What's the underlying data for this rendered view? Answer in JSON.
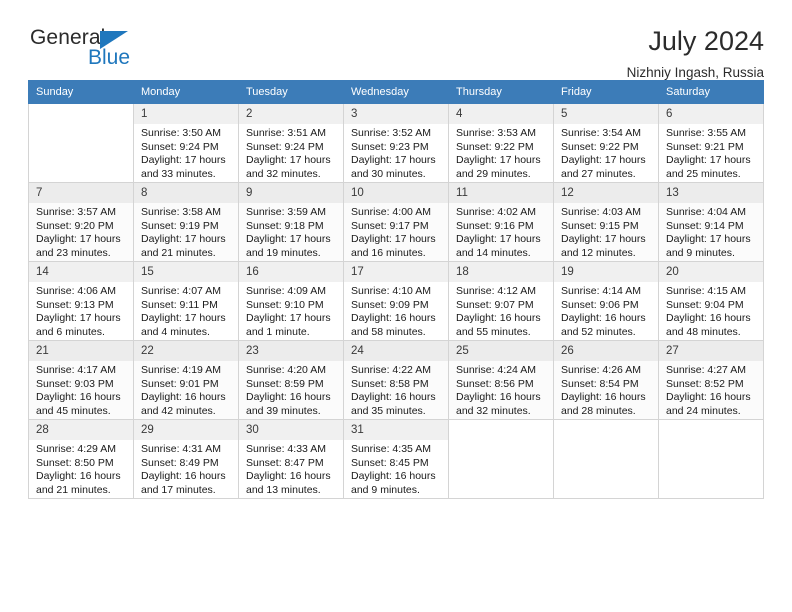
{
  "brand": {
    "name_dark": "General",
    "name_blue": "Blue",
    "accent_color": "#1f77bd",
    "header_color": "#3c7cb8"
  },
  "header": {
    "title": "July 2024",
    "subtitle": "Nizhniy Ingash, Russia"
  },
  "calendar": {
    "weekdays": [
      "Sunday",
      "Monday",
      "Tuesday",
      "Wednesday",
      "Thursday",
      "Friday",
      "Saturday"
    ],
    "weeks": [
      [
        {
          "day": "",
          "sunrise": "",
          "sunset": "",
          "daylight1": "",
          "daylight2": ""
        },
        {
          "day": "1",
          "sunrise": "Sunrise: 3:50 AM",
          "sunset": "Sunset: 9:24 PM",
          "daylight1": "Daylight: 17 hours",
          "daylight2": "and 33 minutes."
        },
        {
          "day": "2",
          "sunrise": "Sunrise: 3:51 AM",
          "sunset": "Sunset: 9:24 PM",
          "daylight1": "Daylight: 17 hours",
          "daylight2": "and 32 minutes."
        },
        {
          "day": "3",
          "sunrise": "Sunrise: 3:52 AM",
          "sunset": "Sunset: 9:23 PM",
          "daylight1": "Daylight: 17 hours",
          "daylight2": "and 30 minutes."
        },
        {
          "day": "4",
          "sunrise": "Sunrise: 3:53 AM",
          "sunset": "Sunset: 9:22 PM",
          "daylight1": "Daylight: 17 hours",
          "daylight2": "and 29 minutes."
        },
        {
          "day": "5",
          "sunrise": "Sunrise: 3:54 AM",
          "sunset": "Sunset: 9:22 PM",
          "daylight1": "Daylight: 17 hours",
          "daylight2": "and 27 minutes."
        },
        {
          "day": "6",
          "sunrise": "Sunrise: 3:55 AM",
          "sunset": "Sunset: 9:21 PM",
          "daylight1": "Daylight: 17 hours",
          "daylight2": "and 25 minutes."
        }
      ],
      [
        {
          "day": "7",
          "sunrise": "Sunrise: 3:57 AM",
          "sunset": "Sunset: 9:20 PM",
          "daylight1": "Daylight: 17 hours",
          "daylight2": "and 23 minutes."
        },
        {
          "day": "8",
          "sunrise": "Sunrise: 3:58 AM",
          "sunset": "Sunset: 9:19 PM",
          "daylight1": "Daylight: 17 hours",
          "daylight2": "and 21 minutes."
        },
        {
          "day": "9",
          "sunrise": "Sunrise: 3:59 AM",
          "sunset": "Sunset: 9:18 PM",
          "daylight1": "Daylight: 17 hours",
          "daylight2": "and 19 minutes."
        },
        {
          "day": "10",
          "sunrise": "Sunrise: 4:00 AM",
          "sunset": "Sunset: 9:17 PM",
          "daylight1": "Daylight: 17 hours",
          "daylight2": "and 16 minutes."
        },
        {
          "day": "11",
          "sunrise": "Sunrise: 4:02 AM",
          "sunset": "Sunset: 9:16 PM",
          "daylight1": "Daylight: 17 hours",
          "daylight2": "and 14 minutes."
        },
        {
          "day": "12",
          "sunrise": "Sunrise: 4:03 AM",
          "sunset": "Sunset: 9:15 PM",
          "daylight1": "Daylight: 17 hours",
          "daylight2": "and 12 minutes."
        },
        {
          "day": "13",
          "sunrise": "Sunrise: 4:04 AM",
          "sunset": "Sunset: 9:14 PM",
          "daylight1": "Daylight: 17 hours",
          "daylight2": "and 9 minutes."
        }
      ],
      [
        {
          "day": "14",
          "sunrise": "Sunrise: 4:06 AM",
          "sunset": "Sunset: 9:13 PM",
          "daylight1": "Daylight: 17 hours",
          "daylight2": "and 6 minutes."
        },
        {
          "day": "15",
          "sunrise": "Sunrise: 4:07 AM",
          "sunset": "Sunset: 9:11 PM",
          "daylight1": "Daylight: 17 hours",
          "daylight2": "and 4 minutes."
        },
        {
          "day": "16",
          "sunrise": "Sunrise: 4:09 AM",
          "sunset": "Sunset: 9:10 PM",
          "daylight1": "Daylight: 17 hours",
          "daylight2": "and 1 minute."
        },
        {
          "day": "17",
          "sunrise": "Sunrise: 4:10 AM",
          "sunset": "Sunset: 9:09 PM",
          "daylight1": "Daylight: 16 hours",
          "daylight2": "and 58 minutes."
        },
        {
          "day": "18",
          "sunrise": "Sunrise: 4:12 AM",
          "sunset": "Sunset: 9:07 PM",
          "daylight1": "Daylight: 16 hours",
          "daylight2": "and 55 minutes."
        },
        {
          "day": "19",
          "sunrise": "Sunrise: 4:14 AM",
          "sunset": "Sunset: 9:06 PM",
          "daylight1": "Daylight: 16 hours",
          "daylight2": "and 52 minutes."
        },
        {
          "day": "20",
          "sunrise": "Sunrise: 4:15 AM",
          "sunset": "Sunset: 9:04 PM",
          "daylight1": "Daylight: 16 hours",
          "daylight2": "and 48 minutes."
        }
      ],
      [
        {
          "day": "21",
          "sunrise": "Sunrise: 4:17 AM",
          "sunset": "Sunset: 9:03 PM",
          "daylight1": "Daylight: 16 hours",
          "daylight2": "and 45 minutes."
        },
        {
          "day": "22",
          "sunrise": "Sunrise: 4:19 AM",
          "sunset": "Sunset: 9:01 PM",
          "daylight1": "Daylight: 16 hours",
          "daylight2": "and 42 minutes."
        },
        {
          "day": "23",
          "sunrise": "Sunrise: 4:20 AM",
          "sunset": "Sunset: 8:59 PM",
          "daylight1": "Daylight: 16 hours",
          "daylight2": "and 39 minutes."
        },
        {
          "day": "24",
          "sunrise": "Sunrise: 4:22 AM",
          "sunset": "Sunset: 8:58 PM",
          "daylight1": "Daylight: 16 hours",
          "daylight2": "and 35 minutes."
        },
        {
          "day": "25",
          "sunrise": "Sunrise: 4:24 AM",
          "sunset": "Sunset: 8:56 PM",
          "daylight1": "Daylight: 16 hours",
          "daylight2": "and 32 minutes."
        },
        {
          "day": "26",
          "sunrise": "Sunrise: 4:26 AM",
          "sunset": "Sunset: 8:54 PM",
          "daylight1": "Daylight: 16 hours",
          "daylight2": "and 28 minutes."
        },
        {
          "day": "27",
          "sunrise": "Sunrise: 4:27 AM",
          "sunset": "Sunset: 8:52 PM",
          "daylight1": "Daylight: 16 hours",
          "daylight2": "and 24 minutes."
        }
      ],
      [
        {
          "day": "28",
          "sunrise": "Sunrise: 4:29 AM",
          "sunset": "Sunset: 8:50 PM",
          "daylight1": "Daylight: 16 hours",
          "daylight2": "and 21 minutes."
        },
        {
          "day": "29",
          "sunrise": "Sunrise: 4:31 AM",
          "sunset": "Sunset: 8:49 PM",
          "daylight1": "Daylight: 16 hours",
          "daylight2": "and 17 minutes."
        },
        {
          "day": "30",
          "sunrise": "Sunrise: 4:33 AM",
          "sunset": "Sunset: 8:47 PM",
          "daylight1": "Daylight: 16 hours",
          "daylight2": "and 13 minutes."
        },
        {
          "day": "31",
          "sunrise": "Sunrise: 4:35 AM",
          "sunset": "Sunset: 8:45 PM",
          "daylight1": "Daylight: 16 hours",
          "daylight2": "and 9 minutes."
        },
        {
          "day": "",
          "sunrise": "",
          "sunset": "",
          "daylight1": "",
          "daylight2": ""
        },
        {
          "day": "",
          "sunrise": "",
          "sunset": "",
          "daylight1": "",
          "daylight2": ""
        },
        {
          "day": "",
          "sunrise": "",
          "sunset": "",
          "daylight1": "",
          "daylight2": ""
        }
      ]
    ]
  }
}
